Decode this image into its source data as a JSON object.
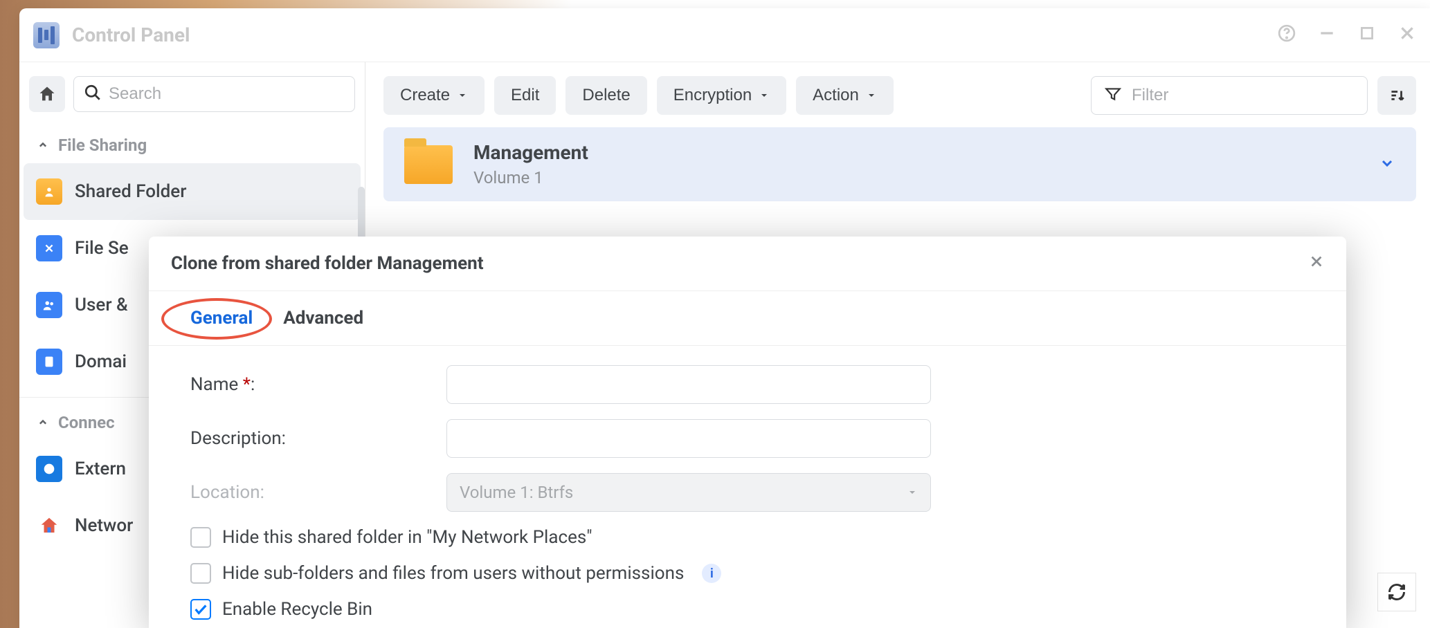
{
  "window": {
    "title": "Control Panel"
  },
  "sidebar": {
    "search_placeholder": "Search",
    "sections": {
      "file_sharing": "File Sharing",
      "connectivity": "Connec"
    },
    "items": {
      "shared_folder": "Shared Folder",
      "file_services": "File Se",
      "user_group": "User &",
      "domain": "Domai",
      "external": "Extern",
      "network": "Networ"
    }
  },
  "toolbar": {
    "create": "Create",
    "edit": "Edit",
    "delete": "Delete",
    "encryption": "Encryption",
    "action": "Action",
    "filter_placeholder": "Filter"
  },
  "list": {
    "item_name": "Management",
    "item_sub": "Volume 1"
  },
  "modal": {
    "title": "Clone from shared folder Management",
    "tabs": {
      "general": "General",
      "advanced": "Advanced"
    },
    "fields": {
      "name_label": "Name",
      "name_colon": ":",
      "description_label": "Description:",
      "location_label": "Location:",
      "location_value": "Volume 1:  Btrfs"
    },
    "checks": {
      "hide_network": "Hide this shared folder in \"My Network Places\"",
      "hide_sub": "Hide sub-folders and files from users without permissions",
      "recycle": "Enable Recycle Bin"
    }
  }
}
